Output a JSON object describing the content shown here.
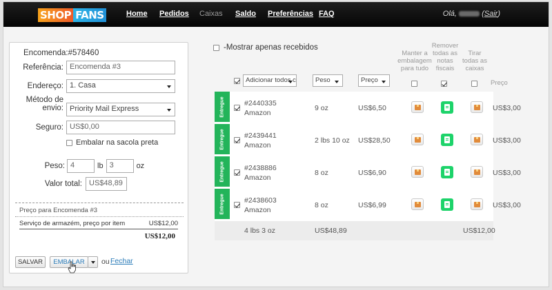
{
  "logo": {
    "shop": "SHOP",
    "fans": "FANS"
  },
  "nav": {
    "items": [
      {
        "label": "Home",
        "active": true
      },
      {
        "label": "Pedidos",
        "active": true
      },
      {
        "label": "Caixas",
        "active": false
      },
      {
        "label": "Saldo",
        "active": true
      },
      {
        "label": "Preferências",
        "active": true
      },
      {
        "label": "FAQ",
        "active": true
      }
    ]
  },
  "user": {
    "greeting": "Olá,",
    "logout": "Sair"
  },
  "form": {
    "order_label": "Encomenda:",
    "order_number": "#578460",
    "reference_label": "Referência:",
    "reference_value": "Encomenda #3",
    "address_label": "Endereço:",
    "address_value": "1. Casa",
    "method_label_1": "Método de",
    "method_label_2": "envio:",
    "method_value": "Priority Mail Express",
    "insurance_label": "Seguro:",
    "insurance_value": "US$0,00",
    "bag_label": "Embalar na sacola preta",
    "weight_label": "Peso:",
    "weight_lb": "4",
    "lb_unit": "lb",
    "weight_oz": "3",
    "oz_unit": "oz",
    "total_label": "Valor total:",
    "total_value": "US$48,89",
    "price_title": "Preço para Encomenda #3",
    "service_label": "Serviço de armazém, preço por item",
    "service_price": "US$12,00",
    "sum": "US$12,00"
  },
  "actions": {
    "save": "SALVAR",
    "pack": "EMBALAR",
    "or": "ou",
    "close": "Fechar"
  },
  "filter": {
    "label": "-Mostrar apenas recebidos"
  },
  "columns": {
    "keep_1": "Manter a",
    "keep_2": "embalagem",
    "keep_3": "para tudo",
    "remove_1": "Remover",
    "remove_2": "todas as",
    "remove_3": "notas",
    "remove_4": "fiscais",
    "take_1": "Tirar",
    "take_2": "todas as",
    "take_3": "caixas",
    "price": "Preço",
    "add_all": "Adicionar todos c",
    "weight_sel": "Peso",
    "price_sel": "Preço"
  },
  "status_label": "Entregue",
  "items": [
    {
      "id": "#2440335",
      "store": "Amazon",
      "weight": "9 oz",
      "value": "US$6,50",
      "fee": "US$3,00"
    },
    {
      "id": "#2439441",
      "store": "Amazon",
      "weight": "2 lbs 10 oz",
      "value": "US$28,50",
      "fee": "US$3,00"
    },
    {
      "id": "#2438886",
      "store": "Amazon",
      "weight": "8 oz",
      "value": "US$6,90",
      "fee": "US$3,00"
    },
    {
      "id": "#2438603",
      "store": "Amazon",
      "weight": "8 oz",
      "value": "US$6,99",
      "fee": "US$3,00"
    }
  ],
  "totals": {
    "weight": "4 lbs 3 oz",
    "value": "US$48,89",
    "fees": "US$12,00"
  }
}
